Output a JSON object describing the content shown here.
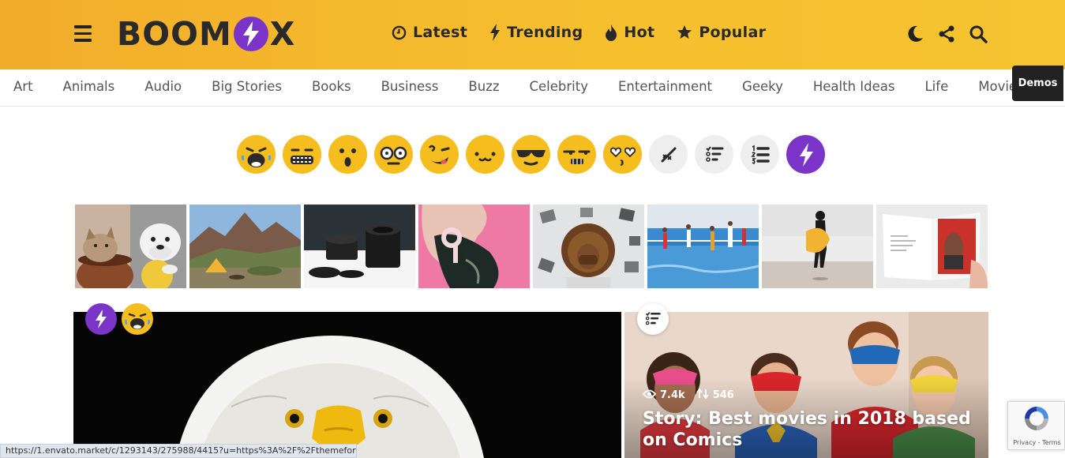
{
  "header": {
    "logo_left": "BOOM",
    "logo_right": "X",
    "nav": [
      {
        "label": "Latest",
        "icon": "clock-icon"
      },
      {
        "label": "Trending",
        "icon": "bolt-icon"
      },
      {
        "label": "Hot",
        "icon": "flame-icon"
      },
      {
        "label": "Popular",
        "icon": "star-icon"
      }
    ],
    "tools": [
      "moon-icon",
      "share-icon",
      "search-icon"
    ],
    "accent": "#f5bd2e"
  },
  "categories": [
    "Art",
    "Animals",
    "Audio",
    "Big Stories",
    "Books",
    "Business",
    "Buzz",
    "Celebrity",
    "Entertainment",
    "Geeky",
    "Health Ideas",
    "Life",
    "Movie"
  ],
  "demos_label": "Demos",
  "reactions": [
    "lol-face-icon",
    "omg-face-icon",
    "wow-face-icon",
    "geeky-face-icon",
    "wtf-face-icon",
    "cute-face-icon",
    "cool-face-icon",
    "fail-face-icon",
    "love-face-icon",
    "poll-icon",
    "list-icon",
    "ranked-list-icon",
    "trending-bolt-icon"
  ],
  "brand_colors": {
    "purple": "#7a35c8",
    "yellow": "#f5bd1e"
  },
  "thumbnails": [
    "cat-and-bulldog",
    "tent-in-mountains",
    "camera-lenses",
    "pink-hair-headphones",
    "woman-with-photos",
    "athletes-running-water",
    "surfer-on-beach",
    "open-magazine"
  ],
  "featured": {
    "main_badges": [
      "trending-bolt-icon",
      "lol-face-icon"
    ],
    "side_badge": "poll-icon",
    "side": {
      "views": "7.4k",
      "votes": "546",
      "title": "Story: Best movies in 2018 based on Comics"
    }
  },
  "status_url": "https://1.envato.market/c/1293143/275988/4415?u=https%3A%2F%2Fthemefores...",
  "recaptcha": {
    "privacy": "Privacy",
    "separator": "-",
    "terms": "Terms"
  }
}
